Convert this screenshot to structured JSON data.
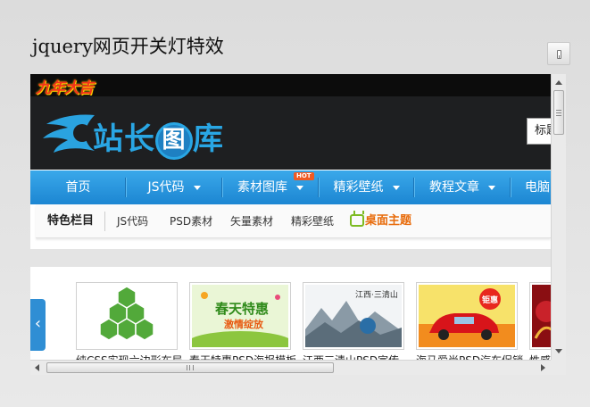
{
  "page": {
    "title": "jquery网页开关灯特效"
  },
  "switch": {
    "icon": "light-switch-icon"
  },
  "site": {
    "topbar_logo": "九年大吉",
    "logo_text_1": "站长",
    "logo_text_circle": "图",
    "logo_text_2": "库",
    "header_tab": "标题",
    "colors": {
      "nav_blue": "#2196dc",
      "accent_orange": "#e86c0c",
      "logo_blue": "#29a6e4"
    }
  },
  "nav": {
    "items": [
      {
        "label": "首页",
        "dropdown": false
      },
      {
        "label": "JS代码",
        "dropdown": true
      },
      {
        "label": "素材图库",
        "dropdown": true,
        "badge": "HOT"
      },
      {
        "label": "精彩壁纸",
        "dropdown": true
      },
      {
        "label": "教程文章",
        "dropdown": true
      },
      {
        "label": "电脑",
        "dropdown": false
      }
    ]
  },
  "subnav": {
    "title": "特色栏目",
    "items": [
      "JS代码",
      "PSD素材",
      "矢量素材",
      "精彩壁纸"
    ],
    "theme": "桌面主题"
  },
  "thumbs": [
    {
      "caption": "纯CSS实现六边形布局"
    },
    {
      "caption": "春天特惠PSD海报模板"
    },
    {
      "caption": "江西三清山PSD宣传"
    },
    {
      "caption": "海马爱尚PSD汽车促销"
    },
    {
      "caption": "性感"
    }
  ],
  "thumb_art": {
    "thumb2_headline": "春天特惠",
    "thumb2_sub": "激情绽放",
    "thumb3_title": "江西·三清山",
    "thumb4_badge": "钜惠"
  }
}
